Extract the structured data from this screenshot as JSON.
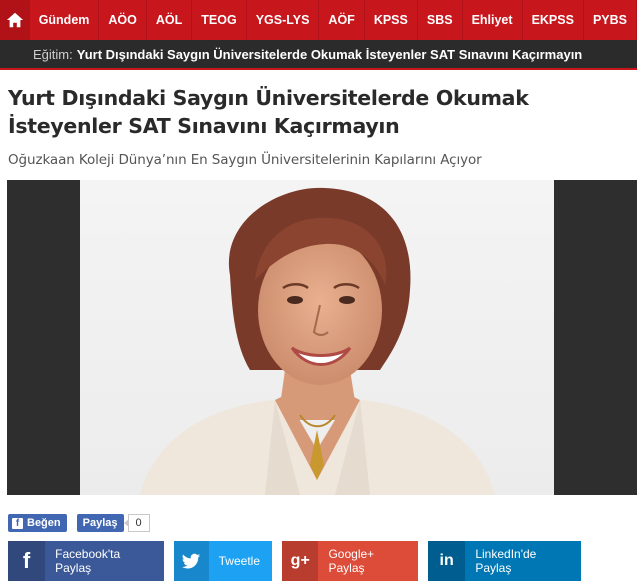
{
  "nav": {
    "items": [
      "Gündem",
      "AÖO",
      "AÖL",
      "TEOG",
      "YGS-LYS",
      "AÖF",
      "KPSS",
      "SBS",
      "Ehliyet",
      "EKPSS",
      "PYBS"
    ]
  },
  "ticker": {
    "label": "Eğitim:",
    "text": "Yurt Dışındaki Saygın Üniversitelerde Okumak İsteyenler SAT Sınavını Kaçırmayın"
  },
  "article": {
    "title": "Yurt Dışındaki Saygın Üniversitelerde Okumak İsteyenler SAT Sınavını Kaçırmayın",
    "subtitle": "Oğuzkaan Koleji Dünya’nın En Saygın Üniversitelerinin Kapılarını Açıyor"
  },
  "share_small": {
    "like_label": "Beğen",
    "share_label": "Paylaş",
    "count": "0"
  },
  "share_buttons": {
    "facebook": "Facebook'ta Paylaş",
    "twitter": "Tweetle",
    "googleplus": "Google+ Paylaş",
    "linkedin": "LinkedIn'de Paylaş"
  },
  "colors": {
    "nav_bg": "#c8161d",
    "ticker_bg": "#2b2b2b",
    "facebook": "#3b5998",
    "twitter": "#1da1f2",
    "googleplus": "#dd4b39",
    "linkedin": "#0077b5"
  },
  "icons": {
    "home": "home-icon",
    "facebook": "facebook-icon",
    "twitter": "twitter-icon",
    "googleplus": "googleplus-icon",
    "linkedin": "linkedin-icon"
  }
}
